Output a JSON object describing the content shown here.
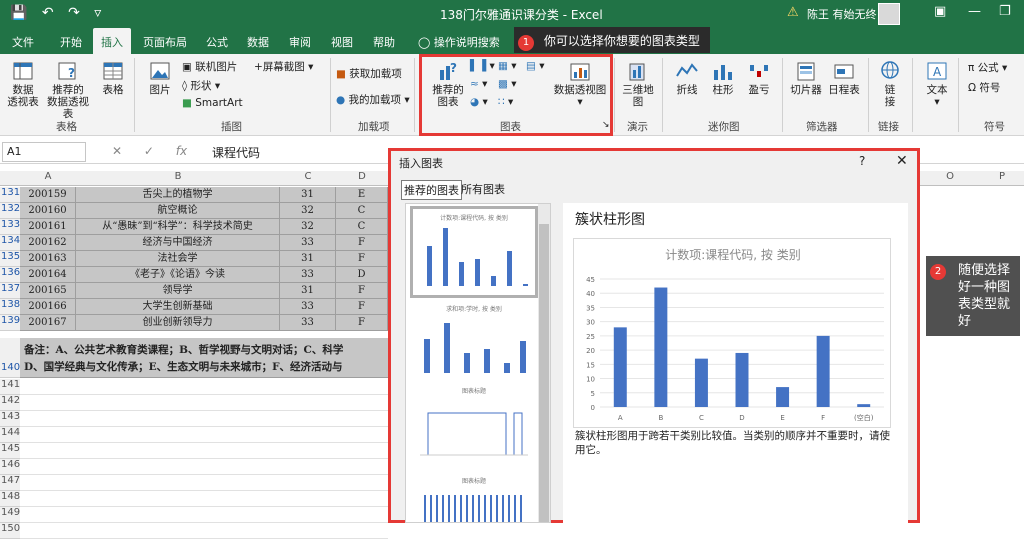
{
  "window": {
    "title": "138门尔雅通识课分类 - Excel",
    "user": "陈王 有始无终"
  },
  "tabs": [
    "文件",
    "开始",
    "插入",
    "页面布局",
    "公式",
    "数据",
    "审阅",
    "视图",
    "帮助"
  ],
  "tell_me": "操作说明搜索",
  "tip1": {
    "number": "1",
    "text": "你可以选择你想要的图表类型"
  },
  "ribbon": {
    "groups": {
      "tables": "表格",
      "illustrations": "插图",
      "addins": "加载项",
      "charts": "图表",
      "tours": "演示",
      "sparklines": "迷你图",
      "filters": "筛选器",
      "links": "链接",
      "symbols": "符号"
    },
    "buttons": {
      "pivot": "数据\n透视表",
      "rec_pivot": "推荐的\n数据透视表",
      "table": "表格",
      "picture": "图片",
      "online_pic": "联机图片",
      "shapes": "形状",
      "smartart": "SmartArt",
      "screenshot": "屏幕截图",
      "get_addins": "获取加载项",
      "my_addins": "我的加载项",
      "rec_charts": "推荐的\n图表",
      "pivot_chart": "数据透视图",
      "map3d": "三维地\n图",
      "line": "折线",
      "column": "柱形",
      "winloss": "盈亏",
      "slicer": "切片器",
      "timeline": "日程表",
      "link": "链\n接",
      "text": "文本",
      "equation": "公式",
      "symbol": "符号"
    }
  },
  "formula_bar": {
    "name_box": "A1",
    "fx": "fx",
    "value": "课程代码"
  },
  "columns": [
    "A",
    "B",
    "C",
    "D",
    "O",
    "P"
  ],
  "rows": [
    {
      "num": "131",
      "code": "200159",
      "name": "舌尖上的植物学",
      "c": "31",
      "d": "E"
    },
    {
      "num": "132",
      "code": "200160",
      "name": "航空概论",
      "c": "32",
      "d": "C"
    },
    {
      "num": "133",
      "code": "200161",
      "name": "从“愚昧”到“科学”：科学技术简史",
      "c": "32",
      "d": "C"
    },
    {
      "num": "134",
      "code": "200162",
      "name": "经济与中国经济",
      "c": "33",
      "d": "F"
    },
    {
      "num": "135",
      "code": "200163",
      "name": "法社会学",
      "c": "31",
      "d": "F"
    },
    {
      "num": "136",
      "code": "200164",
      "name": "《老子》《论语》今读",
      "c": "33",
      "d": "D"
    },
    {
      "num": "137",
      "code": "200165",
      "name": "领导学",
      "c": "31",
      "d": "F"
    },
    {
      "num": "138",
      "code": "200166",
      "name": "大学生创新基础",
      "c": "33",
      "d": "F"
    },
    {
      "num": "139",
      "code": "200167",
      "name": "创业创新领导力",
      "c": "33",
      "d": "F"
    }
  ],
  "note": {
    "line1": "备注：A、公共艺术教育类课程；B、哲学视野与文明对话；C、科学",
    "line2": "D、国学经典与文化传承；E、生态文明与未来城市；F、经济活动与"
  },
  "empty_rows": [
    "140",
    "141",
    "142",
    "143",
    "144",
    "145",
    "146",
    "147",
    "148",
    "149",
    "150"
  ],
  "dialog": {
    "title": "插入图表",
    "help": "?",
    "close": "✕",
    "tabs": [
      "推荐的图表",
      "所有图表"
    ],
    "thumb_titles": [
      "计数项:课程代码, 按 类别",
      "求和项:学时, 按 类别",
      "图表标题",
      "图表标题"
    ],
    "selected_name": "簇状柱形图",
    "description": "簇状柱形图用于跨若干类别比较值。当类别的顺序并不重要时，请使用它。"
  },
  "chart_data": {
    "type": "bar",
    "title": "计数项:课程代码, 按 类别",
    "categories": [
      "A",
      "B",
      "C",
      "D",
      "E",
      "F",
      "(空白)"
    ],
    "values": [
      28,
      42,
      17,
      19,
      7,
      25,
      1
    ],
    "ylim": [
      0,
      45
    ],
    "yticks": [
      0,
      5,
      10,
      15,
      20,
      25,
      30,
      35,
      40,
      45
    ],
    "bar_color": "#4472c4",
    "grid": true
  },
  "tip2": {
    "number": "2",
    "text": "随便选择好一种图表类型就好"
  },
  "colors": {
    "excel_green": "#217346",
    "highlight_red": "#e53935"
  }
}
